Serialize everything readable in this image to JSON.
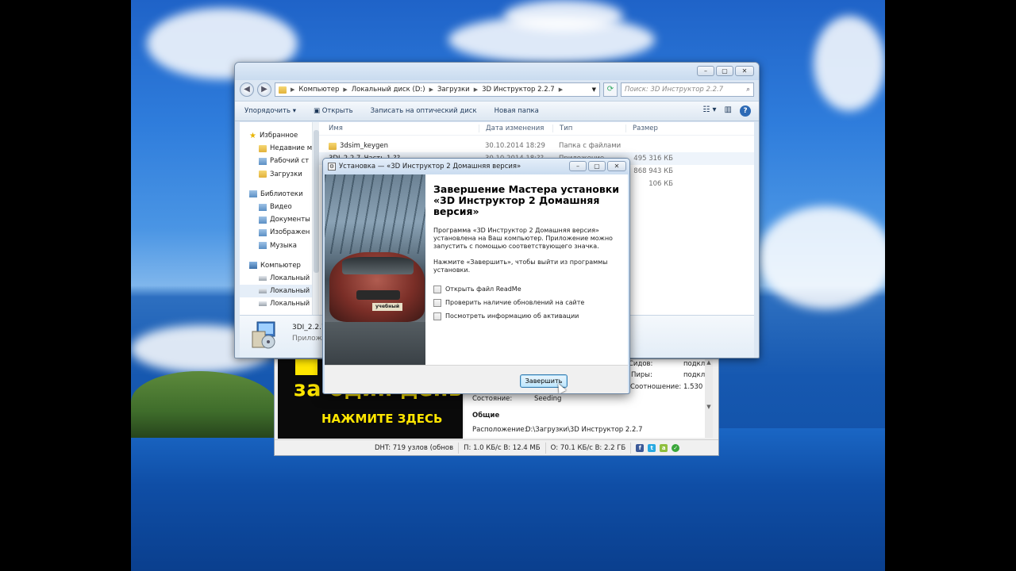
{
  "explorer": {
    "window_buttons": [
      "–",
      "▢",
      "✕"
    ],
    "breadcrumb": [
      "Компьютер",
      "Локальный диск (D:)",
      "Загрузки",
      "3D Инструктор 2.2.7"
    ],
    "search_placeholder": "Поиск: 3D Инструктор 2.2.7",
    "toolbar": {
      "organize": "Упорядочить ▾",
      "open": "Открыть",
      "burn": "Записать на оптический диск",
      "new_folder": "Новая папка"
    },
    "nav": {
      "favorites": "Избранное",
      "recent": "Недавние м",
      "desktop": "Рабочий ст",
      "downloads": "Загрузки",
      "libraries": "Библиотеки",
      "video": "Видео",
      "documents": "Документы",
      "images": "Изображен",
      "music": "Музыка",
      "computer": "Компьютер",
      "drive1": "Локальный",
      "drive2": "Локальный",
      "drive3": "Локальный"
    },
    "columns": {
      "name": "Имя",
      "date": "Дата изменения",
      "type": "Тип",
      "size": "Размер"
    },
    "files": [
      {
        "name": "3dsim_keygen",
        "date": "30.10.2014 18:29",
        "type": "Папка с файлами",
        "size": ""
      },
      {
        "name": "3DI_2.2.7_Часть 1 ??",
        "date": "30.10.2014 18:??",
        "type": "Приложение",
        "size": "495 316 КБ"
      },
      {
        "name": "",
        "date": "",
        "type": "",
        "size": "868 943 КБ"
      },
      {
        "name": "",
        "date": "",
        "type": "",
        "size": "106 КБ"
      }
    ],
    "details": {
      "name": "3DI_2.2.7",
      "sub": "Приложе"
    }
  },
  "torrent": {
    "ad_line1": "за один день",
    "ad_line2": "НАЖМИТЕ ЗДЕСЬ",
    "info": {
      "seeds_label": "Сидов:",
      "seeds_val": "подкл",
      "peers_label": "Пиры:",
      "peers_val": "подкл",
      "ratio_label": "Соотношение:",
      "ratio_val": "1.530",
      "state_label": "Состояние:",
      "state_val": "Seeding",
      "general": "Общие",
      "location_label": "Расположение:",
      "location_val": "D:\\Загрузки\\3D Инструктор 2.2.7"
    },
    "status": {
      "dht": "DHT: 719 узлов  (обнов",
      "download": "П: 1.0 КБ/с В: 12.4 МБ",
      "upload": "О: 70.1 КБ/с В: 2.2 ГБ"
    }
  },
  "installer": {
    "title": "Установка — «3D Инструктор 2 Домашняя версия»",
    "heading": "Завершение Мастера установки «3D Инструктор 2 Домашняя версия»",
    "para1": "Программа «3D Инструктор 2 Домашняя версия» установлена на Ваш компьютер. Приложение можно запустить с помощью соответствующего значка.",
    "para2": "Нажмите «Завершить», чтобы выйти из программы установки.",
    "options": [
      "Открыть файл ReadMe",
      "Проверить наличие обновлений на сайте",
      "Посмотреть информацию об активации"
    ],
    "plate": "учебный",
    "finish_label": "Завершить"
  }
}
